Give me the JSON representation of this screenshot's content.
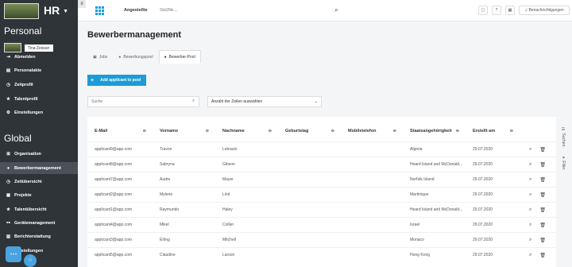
{
  "sidebar": {
    "brand": "HR",
    "personal_title": "Personal",
    "user_name": "Tina Zeisser",
    "personal_items": [
      {
        "label": "Abmelden",
        "icon": "logout-icon"
      },
      {
        "label": "Personalakte",
        "icon": "id-card-icon"
      },
      {
        "label": "Zeitprofil",
        "icon": "clock-icon"
      },
      {
        "label": "Talentprofil",
        "icon": "star-icon"
      },
      {
        "label": "Einstellungen",
        "icon": "gear-icon"
      }
    ],
    "global_title": "Global",
    "global_items": [
      {
        "label": "Organisation",
        "icon": "sitemap-icon"
      },
      {
        "label": "Bewerbermanagement",
        "icon": "user-icon",
        "active": true
      },
      {
        "label": "Zeitübersicht",
        "icon": "clock-icon"
      },
      {
        "label": "Projekte",
        "icon": "briefcase-icon"
      },
      {
        "label": "Talentübersicht",
        "icon": "star-icon"
      },
      {
        "label": "Gerätemanagement",
        "icon": "devices-icon"
      },
      {
        "label": "Berichterstattung",
        "icon": "chart-icon"
      },
      {
        "label": "Einstellungen",
        "icon": "gear-icon"
      }
    ]
  },
  "topbar": {
    "menu_glyph": "≡",
    "title": "Angestellte",
    "search_placeholder": "Suche...",
    "notifications_label": "Benachrichtigungen"
  },
  "page": {
    "title": "Bewerbermanagement",
    "tabs": [
      {
        "label": "Jobs",
        "icon": "briefcase-icon"
      },
      {
        "label": "Bewerbungspool",
        "icon": "user-icon"
      },
      {
        "label": "Bewerber-Pool",
        "icon": "user-icon",
        "active": true
      }
    ],
    "add_button": "Add applicant to pool",
    "filter_placeholder": "Suche",
    "rows_select": "Anzahl der Zeilen auswählen"
  },
  "table": {
    "columns": [
      "E-Mail",
      "Vorname",
      "Nachname",
      "Geburtstag",
      "Mobiletelefon",
      "Staatsangehörigkeit",
      "Erstellt am"
    ],
    "rows": [
      [
        "applicant9@app.com",
        "Travon",
        "Lebsack",
        "",
        "",
        "Algeria",
        "29.07.2020"
      ],
      [
        "applicant8@app.com",
        "Sabryna",
        "Gibson",
        "",
        "",
        "Heard Island and McDonald...",
        "29.07.2020"
      ],
      [
        "applicant7@app.com",
        "Audre",
        "Mayer",
        "",
        "",
        "Norfolk Island",
        "29.07.2020"
      ],
      [
        "applicant2@app.com",
        "Mylene",
        "Lind",
        "",
        "",
        "Martinique",
        "29.07.2020"
      ],
      [
        "applicant1@app.com",
        "Raymundo",
        "Haley",
        "",
        "",
        "Heard Island and McDonald...",
        "29.07.2020"
      ],
      [
        "applicant4@app.com",
        "Mikel",
        "Collier",
        "",
        "",
        "Israel",
        "29.07.2020"
      ],
      [
        "applicant3@app.com",
        "Erling",
        "Mitchell",
        "",
        "",
        "Monaco",
        "29.07.2020"
      ],
      [
        "applicant5@app.com",
        "Claudine",
        "Larson",
        "",
        "",
        "Hong Kong",
        "29.07.2020"
      ]
    ]
  },
  "side_tabs": {
    "suchen": "Suchen",
    "filter": "Filter"
  },
  "colors": {
    "accent": "#1a9cd6",
    "sidebar": "#2f3438"
  }
}
